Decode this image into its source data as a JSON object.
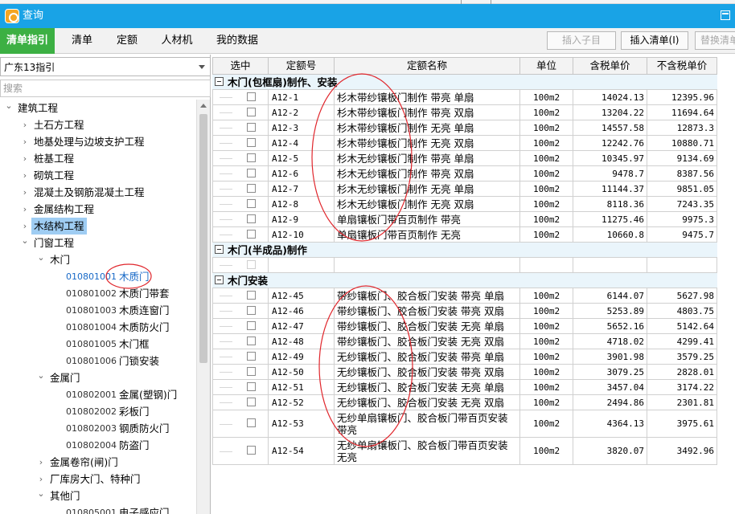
{
  "window": {
    "title": "查询"
  },
  "tabs": [
    {
      "label": "清单指引",
      "active": true
    },
    {
      "label": "清单",
      "active": false
    },
    {
      "label": "定额",
      "active": false
    },
    {
      "label": "人材机",
      "active": false
    },
    {
      "label": "我的数据",
      "active": false
    }
  ],
  "toolbar": {
    "insert_child_label": "插入子目",
    "insert_list_label": "插入清单(I)",
    "replace_list_label": "替换清单"
  },
  "left_panel": {
    "dropdown_value": "广东13指引",
    "search_placeholder": "搜索",
    "tree": [
      {
        "label": "建筑工程",
        "twisty": "expanded"
      },
      {
        "label": "土石方工程",
        "twisty": "collapsed"
      },
      {
        "label": "地基处理与边坡支护工程",
        "twisty": "collapsed"
      },
      {
        "label": "桩基工程",
        "twisty": "collapsed"
      },
      {
        "label": "砌筑工程",
        "twisty": "collapsed"
      },
      {
        "label": "混凝土及钢筋混凝土工程",
        "twisty": "collapsed"
      },
      {
        "label": "金属结构工程",
        "twisty": "collapsed"
      },
      {
        "label": "木结构工程",
        "twisty": "collapsed",
        "selected": true
      },
      {
        "label": "门窗工程",
        "twisty": "expanded"
      },
      {
        "label": "木门",
        "twisty": "expanded"
      },
      {
        "code": "010801001",
        "label": "木质门",
        "highlight": true
      },
      {
        "code": "010801002",
        "label": "木质门带套"
      },
      {
        "code": "010801003",
        "label": "木质连窗门"
      },
      {
        "code": "010801004",
        "label": "木质防火门"
      },
      {
        "code": "010801005",
        "label": "木门框"
      },
      {
        "code": "010801006",
        "label": "门锁安装"
      },
      {
        "label": "金属门",
        "twisty": "expanded"
      },
      {
        "code": "010802001",
        "label": "金属(塑钢)门"
      },
      {
        "code": "010802002",
        "label": "彩板门"
      },
      {
        "code": "010802003",
        "label": "钢质防火门"
      },
      {
        "code": "010802004",
        "label": "防盗门"
      },
      {
        "label": "金属卷帘(闸)门",
        "twisty": "collapsed"
      },
      {
        "label": "厂库房大门、特种门",
        "twisty": "collapsed"
      },
      {
        "label": "其他门",
        "twisty": "expanded"
      },
      {
        "code": "010805001",
        "label": "电子感应门"
      }
    ]
  },
  "grid": {
    "headers": [
      "选中",
      "定额号",
      "定额名称",
      "单位",
      "含税单价",
      "不含税单价"
    ],
    "sections": [
      {
        "title": "木门(包框扇)制作、安装",
        "rows": [
          {
            "code": "A12-1",
            "name": "杉木带纱镶板门制作 带亮 单扇",
            "unit": "100m2",
            "price_tax": "14024.13",
            "price_notax": "12395.96"
          },
          {
            "code": "A12-2",
            "name": "杉木带纱镶板门制作 带亮 双扇",
            "unit": "100m2",
            "price_tax": "13204.22",
            "price_notax": "11694.64"
          },
          {
            "code": "A12-3",
            "name": "杉木带纱镶板门制作 无亮 单扇",
            "unit": "100m2",
            "price_tax": "14557.58",
            "price_notax": "12873.3"
          },
          {
            "code": "A12-4",
            "name": "杉木带纱镶板门制作 无亮 双扇",
            "unit": "100m2",
            "price_tax": "12242.76",
            "price_notax": "10880.71"
          },
          {
            "code": "A12-5",
            "name": "杉木无纱镶板门制作 带亮 单扇",
            "unit": "100m2",
            "price_tax": "10345.97",
            "price_notax": "9134.69"
          },
          {
            "code": "A12-6",
            "name": "杉木无纱镶板门制作 带亮 双扇",
            "unit": "100m2",
            "price_tax": "9478.7",
            "price_notax": "8387.56"
          },
          {
            "code": "A12-7",
            "name": "杉木无纱镶板门制作 无亮 单扇",
            "unit": "100m2",
            "price_tax": "11144.37",
            "price_notax": "9851.05"
          },
          {
            "code": "A12-8",
            "name": "杉木无纱镶板门制作 无亮 双扇",
            "unit": "100m2",
            "price_tax": "8118.36",
            "price_notax": "7243.35"
          },
          {
            "code": "A12-9",
            "name": "单扇镶板门带百页制作 带亮",
            "unit": "100m2",
            "price_tax": "11275.46",
            "price_notax": "9975.3"
          },
          {
            "code": "A12-10",
            "name": "单扇镶板门带百页制作 无亮",
            "unit": "100m2",
            "price_tax": "10660.8",
            "price_notax": "9475.7"
          }
        ]
      },
      {
        "title": "木门(半成品)制作",
        "rows": [
          {
            "code": "",
            "name": "",
            "unit": "",
            "price_tax": "",
            "price_notax": "",
            "empty": true
          }
        ]
      },
      {
        "title": "木门安装",
        "rows": [
          {
            "code": "A12-45",
            "name": "带纱镶板门、胶合板门安装 带亮 单扇",
            "unit": "100m2",
            "price_tax": "6144.07",
            "price_notax": "5627.98"
          },
          {
            "code": "A12-46",
            "name": "带纱镶板门、胶合板门安装 带亮 双扇",
            "unit": "100m2",
            "price_tax": "5253.89",
            "price_notax": "4803.75"
          },
          {
            "code": "A12-47",
            "name": "带纱镶板门、胶合板门安装 无亮 单扇",
            "unit": "100m2",
            "price_tax": "5652.16",
            "price_notax": "5142.64"
          },
          {
            "code": "A12-48",
            "name": "带纱镶板门、胶合板门安装 无亮 双扇",
            "unit": "100m2",
            "price_tax": "4718.02",
            "price_notax": "4299.41"
          },
          {
            "code": "A12-49",
            "name": "无纱镶板门、胶合板门安装 带亮 单扇",
            "unit": "100m2",
            "price_tax": "3901.98",
            "price_notax": "3579.25"
          },
          {
            "code": "A12-50",
            "name": "无纱镶板门、胶合板门安装 带亮 双扇",
            "unit": "100m2",
            "price_tax": "3079.25",
            "price_notax": "2828.01"
          },
          {
            "code": "A12-51",
            "name": "无纱镶板门、胶合板门安装 无亮 单扇",
            "unit": "100m2",
            "price_tax": "3457.04",
            "price_notax": "3174.22"
          },
          {
            "code": "A12-52",
            "name": "无纱镶板门、胶合板门安装 无亮 双扇",
            "unit": "100m2",
            "price_tax": "2494.86",
            "price_notax": "2301.81"
          },
          {
            "code": "A12-53",
            "name": "无纱单扇镶板门、胶合板门带百页安装 带亮",
            "unit": "100m2",
            "price_tax": "4364.13",
            "price_notax": "3975.61",
            "tall": true
          },
          {
            "code": "A12-54",
            "name": "无纱单扇镶板门、胶合板门带百页安装 无亮",
            "unit": "100m2",
            "price_tax": "3820.07",
            "price_notax": "3492.96",
            "tall": true
          }
        ]
      }
    ]
  },
  "colors": {
    "titlebar": "#19a3e6",
    "active_tab": "#3cb043",
    "tree_selected": "#9fcdf3",
    "link_blue": "#1769c7",
    "annotation_red": "#e0262c"
  }
}
